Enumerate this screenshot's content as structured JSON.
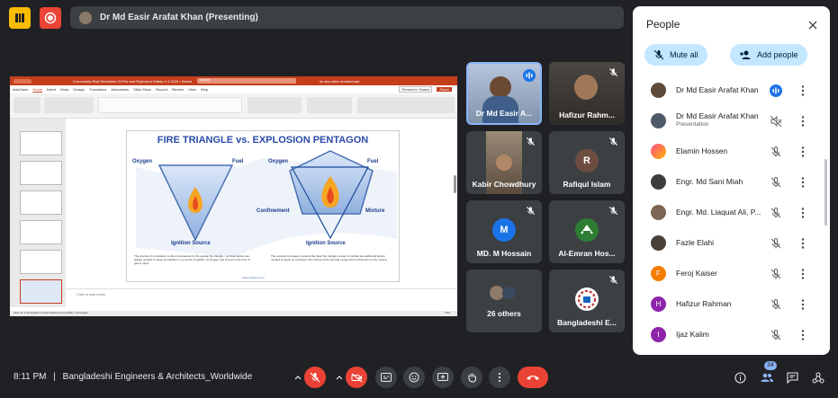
{
  "presenter_bar": {
    "label": "Dr Md Easir Arafat Khan (Presenting)"
  },
  "slide": {
    "window_title": "Community Risk Reduction Of Fire and Explosion Safety 1-4 2024 • Saved",
    "search_placeholder": "Search",
    "user": "sk abu zafar mohammad",
    "present_label": "Present in Teams",
    "share_label": "Share",
    "menu": [
      "AutoSave",
      "Home",
      "Insert",
      "Draw",
      "Design",
      "Transitions",
      "Animations",
      "Slide Show",
      "Record",
      "Review",
      "View",
      "Help"
    ],
    "title": "FIRE TRIANGLE vs. EXPLOSION PENTAGON",
    "labels": {
      "oxygen_left": "Oxygen",
      "fuel_left": "Fuel",
      "ignition_left": "Ignition Source",
      "oxygen_right": "Oxygen",
      "fuel_right": "Fuel",
      "confinement": "Confinement",
      "mixture": "Mixture",
      "ignition_right": "Ignition Source"
    },
    "caption_left": "The process of combustion is often represented by the popular fire triangle – as three factors are always needed to cause combustion: 1) a source of ignition, 2) Oxygen and 3) Fuel in the form of gas or vapor",
    "caption_right": "The explosion pentagon expands the basic fire triangle concept to include two additional factors needed to cause an explosion: the mixture of the fuel and oxygen and confinement of the mixture",
    "footer_url": "www.newtech.com",
    "notes": "Click to add notes",
    "status": "Slide 11 of 16    English (United States)    Accessibility: Investigate",
    "zoom": "79%"
  },
  "tiles": [
    {
      "name": "Dr Md Easir A...",
      "type": "video",
      "speaking": true
    },
    {
      "name": "Hafizur Rahm...",
      "type": "video",
      "muted": true
    },
    {
      "name": "Kabir Chowdhury",
      "type": "video",
      "muted": true
    },
    {
      "name": "Rafiqul Islam",
      "type": "avatar",
      "initial": "R",
      "color": "#6d4c41",
      "muted": true
    },
    {
      "name": "MD. M Hossain",
      "type": "avatar",
      "initial": "M",
      "color": "#1a73e8",
      "muted": true
    },
    {
      "name": "Al-Emran Hos...",
      "type": "logo",
      "muted": true
    },
    {
      "name": "26 others",
      "type": "others"
    },
    {
      "name": "Bangladeshi E...",
      "type": "logo2",
      "muted": true
    }
  ],
  "people": {
    "title": "People",
    "mute_all": "Mute all",
    "add_people": "Add people",
    "list": [
      {
        "name": "Dr Md Easir Arafat Khan",
        "sub": "",
        "status": "speaking",
        "avatar": "photo"
      },
      {
        "name": "Dr Md Easir Arafat Khan",
        "sub": "Presentation",
        "status": "presenting",
        "avatar": "photo"
      },
      {
        "name": "Elamin Hossen",
        "sub": "",
        "status": "muted",
        "avatar": "gradient"
      },
      {
        "name": "Engr. Md Sani Miah",
        "sub": "",
        "status": "muted",
        "avatar": "photo"
      },
      {
        "name": "Engr. Md. Liaquat Ali, P...",
        "sub": "",
        "status": "muted",
        "avatar": "photo"
      },
      {
        "name": "Fazle Elahi",
        "sub": "",
        "status": "muted",
        "avatar": "photo"
      },
      {
        "name": "Feroj Kaiser",
        "sub": "",
        "status": "muted",
        "avatar": "F",
        "color": "#f57c00"
      },
      {
        "name": "Hafizur Rahman",
        "sub": "",
        "status": "muted",
        "avatar": "H",
        "color": "#8e24aa"
      },
      {
        "name": "Ijaz Kalim",
        "sub": "",
        "status": "muted",
        "avatar": "I",
        "color": "#8e24aa"
      }
    ]
  },
  "bottom": {
    "time": "8:11 PM",
    "separator": "|",
    "meeting": "Bangladeshi Engineers & Architects_Worldwide",
    "participant_count": "34"
  }
}
